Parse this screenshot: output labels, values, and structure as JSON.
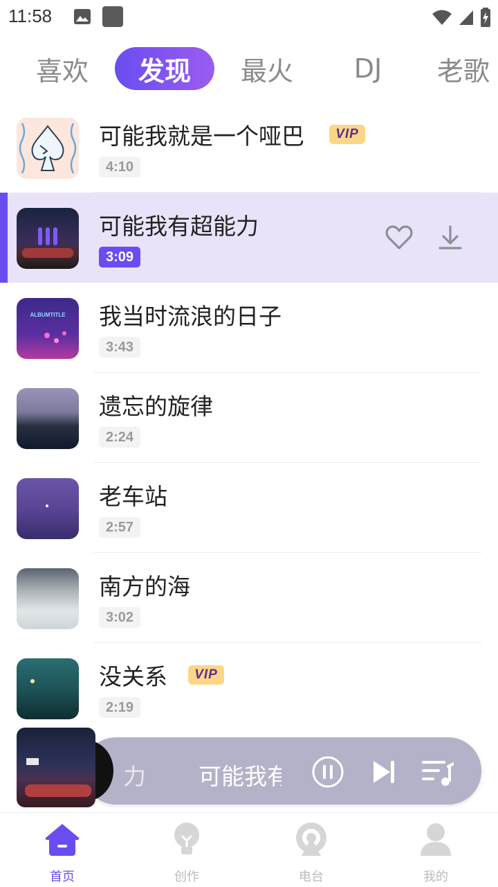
{
  "status_bar": {
    "time": "11:58"
  },
  "tabs": [
    {
      "label": "喜欢"
    },
    {
      "label": "发现",
      "active": true
    },
    {
      "label": "最火"
    },
    {
      "label": "DJ"
    },
    {
      "label": "老歌"
    }
  ],
  "songs": [
    {
      "title": "可能我就是一个哑巴",
      "duration": "4:10",
      "vip": "VIP"
    },
    {
      "title": "可能我有超能力",
      "duration": "3:09",
      "current": true
    },
    {
      "title": "我当时流浪的日子",
      "duration": "3:43",
      "cover_text": "ALBUMTITLE"
    },
    {
      "title": "遗忘的旋律",
      "duration": "2:24"
    },
    {
      "title": "老车站",
      "duration": "2:57"
    },
    {
      "title": "南方的海",
      "duration": "3:02"
    },
    {
      "title": "没关系",
      "duration": "2:19",
      "vip": "VIP"
    }
  ],
  "mini_player": {
    "prev_fragment": "力",
    "title": "可能我有超能力"
  },
  "bottom_nav": [
    {
      "label": "首页",
      "icon": "home-icon",
      "active": true
    },
    {
      "label": "创作",
      "icon": "bulb-icon"
    },
    {
      "label": "电台",
      "icon": "radio-icon"
    },
    {
      "label": "我的",
      "icon": "user-icon"
    }
  ],
  "colors": {
    "accent": "#6a4df0",
    "highlight_row": "#e9e3fa",
    "vip_bg": "#fbd686",
    "player_bar": "#b4b2c8"
  }
}
